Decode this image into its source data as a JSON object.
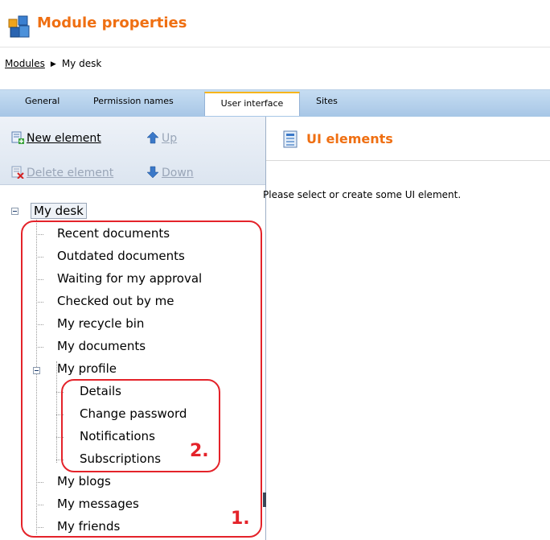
{
  "header": {
    "title": "Module properties",
    "icon": "module-blocks-icon"
  },
  "breadcrumb": {
    "link": "Modules",
    "separator": "▶",
    "current": "My desk"
  },
  "tabs": [
    {
      "label": "General"
    },
    {
      "label": "Permission names"
    },
    {
      "label": "User interface",
      "active": true
    },
    {
      "label": "Sites"
    }
  ],
  "toolbar": {
    "new_element": "New element",
    "up": "Up",
    "delete_element": "Delete element",
    "down": "Down"
  },
  "tree": {
    "root": "My desk",
    "items": [
      "Recent documents",
      "Outdated documents",
      "Waiting for my approval",
      "Checked out by me",
      "My recycle bin",
      "My documents",
      "My profile",
      "Details",
      "Change password",
      "Notifications",
      "Subscriptions",
      "My blogs",
      "My messages",
      "My friends"
    ]
  },
  "annotations": {
    "outer": "1.",
    "inner": "2.",
    "color": "#e4232a"
  },
  "right": {
    "title": "UI elements",
    "message": "Please select or create some UI element."
  },
  "colors": {
    "accent": "#ef6f12",
    "tabbar": "#b6d1ed",
    "active_tab_border": "#f7b51b"
  }
}
